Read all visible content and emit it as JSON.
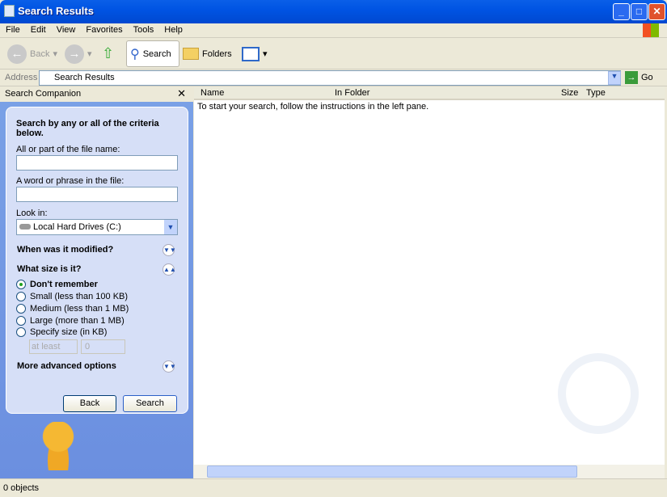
{
  "window": {
    "title": "Search Results"
  },
  "menu": [
    "File",
    "Edit",
    "View",
    "Favorites",
    "Tools",
    "Help"
  ],
  "toolbar": {
    "back": "Back",
    "search": "Search",
    "folders": "Folders"
  },
  "address": {
    "label": "Address",
    "value": "Search Results",
    "go": "Go"
  },
  "companion": {
    "title": "Search Companion",
    "heading": "Search by any or all of the criteria below.",
    "filename_label": "All or part of the file name:",
    "filename_value": "",
    "phrase_label": "A word or phrase in the file:",
    "phrase_value": "",
    "lookin_label": "Look in:",
    "lookin_value": "Local Hard Drives (C:)",
    "modified": "When was it modified?",
    "size": "What size is it?",
    "size_options": [
      "Don't remember",
      "Small (less than 100 KB)",
      "Medium (less than 1 MB)",
      "Large (more than 1 MB)",
      "Specify size (in KB)"
    ],
    "selected_size": 0,
    "atleast": "at least",
    "size_value": "0",
    "advanced": "More advanced options",
    "back": "Back",
    "search": "Search"
  },
  "list": {
    "columns": [
      "Name",
      "In Folder",
      "Size",
      "Type"
    ],
    "message": "To start your search, follow the instructions in the left pane."
  },
  "status": "0 objects"
}
